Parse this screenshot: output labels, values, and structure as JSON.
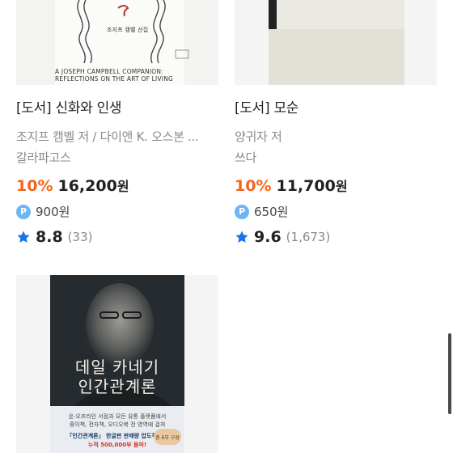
{
  "products": [
    {
      "title": "[도서] 신화와 인생",
      "authors": "조지프 캠벨 저 / 다이앤 K. 오스본 ...",
      "publisher": "갈라파고스",
      "discount": "10%",
      "price": "16,200",
      "price_unit": "원",
      "points_badge": "P",
      "points": "900원",
      "rating": "8.8",
      "review_count": "(33)",
      "cover": {
        "title_ko": "조지프 캠벨 선집",
        "line1": "A JOSEPH CAMPBELL COMPANION:",
        "line2": "REFLECTIONS ON THE ART OF LIVING",
        "publisher_mark": "갈라파고스"
      }
    },
    {
      "title": "[도서] 모순",
      "authors": "양귀자 저",
      "publisher": "쓰다",
      "discount": "10%",
      "price": "11,700",
      "price_unit": "원",
      "points_badge": "P",
      "points": "650원",
      "rating": "9.6",
      "review_count": "(1,673)"
    },
    {
      "cover": {
        "title_line1": "데일 카네기",
        "title_line2": "인간관계론",
        "blurb1": "온·오프라인 서점과 모든 유통 플랫폼에서",
        "blurb2": "종이책, 전자책, 오디오북 전 영역에 걸쳐",
        "blurb3": "「인간관계론」 한글판 판매량 압도적 1위",
        "blurb4": "누적 500,000부 돌파!",
        "sticker": "총 6부 구성"
      }
    }
  ],
  "colors": {
    "discount": "#f2661c",
    "point_badge": "#6fb5f2",
    "star": "#1a73e8",
    "muted_text": "#8a8a8a"
  }
}
